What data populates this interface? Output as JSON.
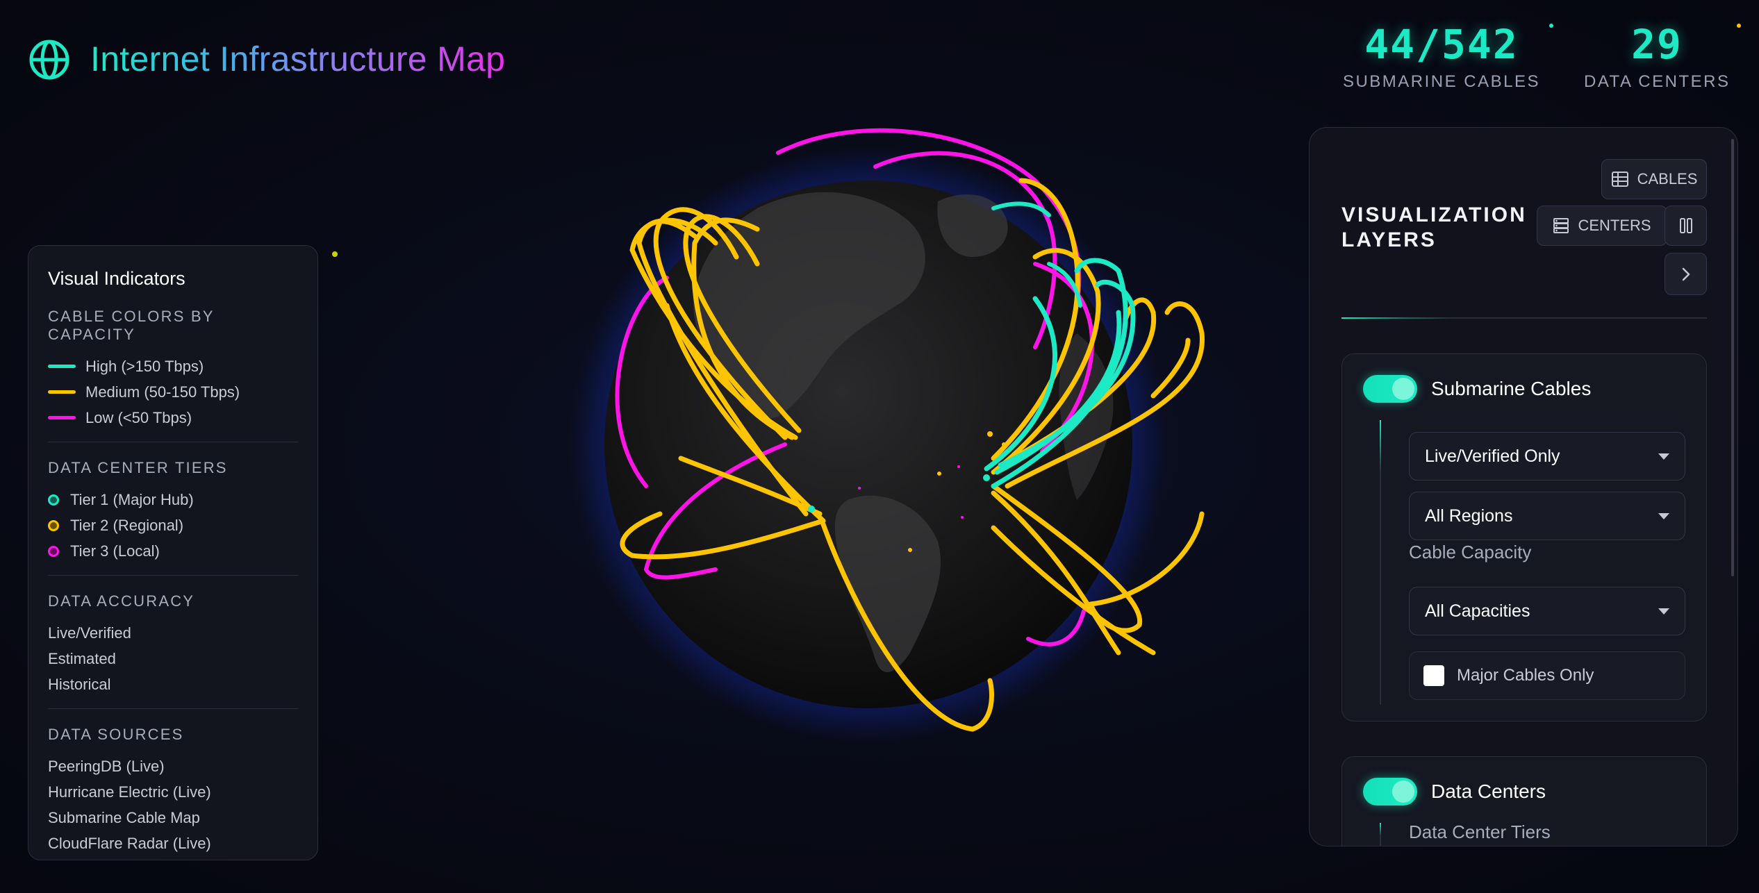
{
  "header": {
    "title": "Internet Infrastructure Map",
    "stats": [
      {
        "value": "44/542",
        "label": "SUBMARINE CABLES"
      },
      {
        "value": "29",
        "label": "DATA CENTERS"
      }
    ]
  },
  "colors": {
    "high": "#1de9c4",
    "medium": "#ffc400",
    "low": "#ff14e8",
    "accent": "#1de9c4"
  },
  "legend": {
    "title": "Visual Indicators",
    "cable_colors": {
      "title": "CABLE COLORS BY CAPACITY",
      "items": [
        {
          "label": "High (>150 Tbps)"
        },
        {
          "label": "Medium (50-150 Tbps)"
        },
        {
          "label": "Low (<50 Tbps)"
        }
      ]
    },
    "tiers": {
      "title": "DATA CENTER TIERS",
      "items": [
        {
          "label": "Tier 1 (Major Hub)"
        },
        {
          "label": "Tier 2 (Regional)"
        },
        {
          "label": "Tier 3 (Local)"
        }
      ]
    },
    "accuracy": {
      "title": "DATA ACCURACY",
      "items": [
        "Live/Verified",
        "Estimated",
        "Historical"
      ]
    },
    "sources": {
      "title": "DATA SOURCES",
      "items": [
        "PeeringDB (Live)",
        "Hurricane Electric (Live)",
        "Submarine Cable Map",
        "CloudFlare Radar (Live)"
      ]
    }
  },
  "panel": {
    "title": "VISUALIZATION LAYERS",
    "buttons": {
      "cables": "CABLES",
      "centers": "CENTERS"
    },
    "cables_group": {
      "label": "Submarine Cables",
      "accuracy_select": "Live/Verified Only",
      "region_select": "All Regions",
      "capacity_label": "Cable Capacity",
      "capacity_select": "All Capacities",
      "major_only": "Major Cables Only"
    },
    "centers_group": {
      "label": "Data Centers",
      "tiers_label": "Data Center Tiers"
    }
  }
}
